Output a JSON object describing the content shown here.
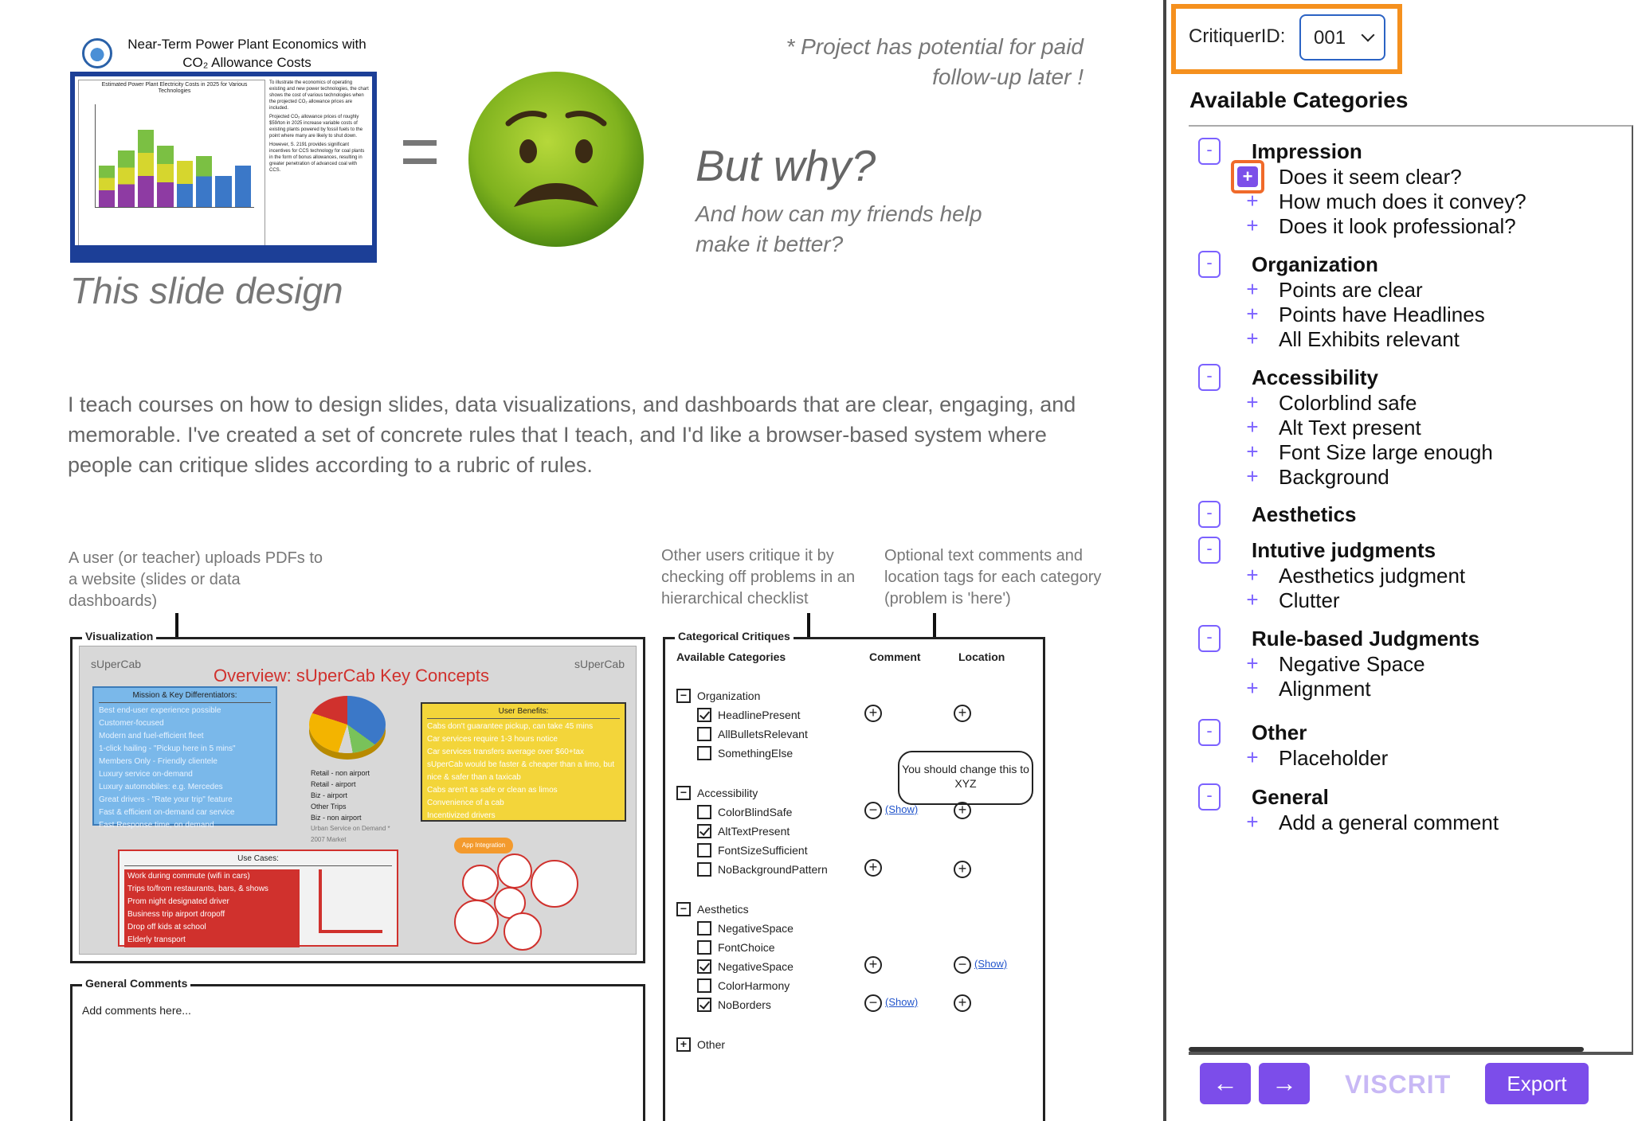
{
  "slide": {
    "thumb_title": "Near-Term Power Plant Economics with CO₂ Allowance Costs",
    "thumb_chart_title": "Estimated Power Plant Electricity Costs in 2025 for Various Technologies",
    "thumb_notes": [
      "To illustrate the economics of operating existing and new power technologies, the chart shows the cost of various technologies when the projected CO₂ allowance prices are included.",
      "Projected CO₂ allowance prices of roughly $59/ton in 2025 increase variable costs of existing plants powered by fossil fuels to the point where many are likely to shut down.",
      "However, S. 2191 provides significant incentives for CCS technology for coal plants in the form of bonus allowances, resulting in greater penetration of advanced coal with CCS."
    ],
    "caption_design": "This slide design",
    "note_top": "* Project has potential for paid follow-up later !",
    "but_why": "But why?",
    "friends": "And how can my friends help make it better?",
    "intro": "I teach courses on how to design slides, data visualizations, and dashboards that are clear, engaging, and memorable. I've created a set of concrete rules that I teach, and I'd like a browser-based system where people can critique slides according to a rubric of rules.",
    "anno_upload": "A user (or teacher) uploads PDFs to a website (slides or data dashboards)",
    "anno_critique": "Other users critique it by checking off problems in an hierarchical checklist",
    "anno_comments": "Optional text comments and location tags for each category (problem is 'here')"
  },
  "mock_viz": {
    "label": "Visualization",
    "brand_left": "sUperCab",
    "brand_right": "sUperCab",
    "title": "Overview: sUperCab Key Concepts",
    "mission_title": "Mission & Key Differentiators:",
    "mission_items": [
      "Best end-user experience possible",
      "Customer-focused",
      "Modern and fuel-efficient fleet",
      "1-click hailing - \"Pickup here in 5 mins\"",
      "Members Only - Friendly clientele",
      "Luxury service on-demand",
      "Luxury automobiles: e.g. Mercedes",
      "Great drivers - \"Rate your trip\" feature",
      "Fast & efficient on-demand car service",
      "Fast Response time, on demand"
    ],
    "benefits_title": "User Benefits:",
    "benefits_items": [
      "Cabs don't guarantee pickup, can take 45 mins",
      "Car services require 1-3 hours notice",
      "Car services transfers average over $60+tax",
      "sUperCab would be faster & cheaper than a limo, but nice & safer than a taxicab",
      "Cabs aren't as safe or clean as limos",
      "Convenience of a cab",
      "Incentivized drivers"
    ],
    "legend": [
      "Retail - non airport",
      "Retail - airport",
      "Biz - airport",
      "Other Trips",
      "Biz - non airport"
    ],
    "legend_note": "Urban Service on Demand * 2007 Market",
    "usecases_title": "Use Cases:",
    "usecases_items": [
      "Work during commute (wifi in cars)",
      "Trips to/from restaurants, bars, & shows",
      "Prom night designated driver",
      "Business trip airport dropoff",
      "Drop off kids at school",
      "Elderly transport"
    ],
    "app_label": "App Integration"
  },
  "mock_gc": {
    "label": "General Comments",
    "placeholder": "Add comments here..."
  },
  "mock_cat": {
    "label": "Categorical Critiques",
    "avail": "Available Categories",
    "comment_col": "Comment",
    "location_col": "Location",
    "org": "Organization",
    "org_items": [
      "HeadlinePresent",
      "AllBulletsRelevant",
      "SomethingElse"
    ],
    "acc": "Accessibility",
    "acc_items": [
      "ColorBlindSafe",
      "AltTextPresent",
      "FontSizeSufficient",
      "NoBackgroundPattern"
    ],
    "aes": "Aesthetics",
    "aes_items": [
      "NegativeSpace",
      "FontChoice",
      "NegativeSpace",
      "ColorHarmony",
      "NoBorders"
    ],
    "other": "Other",
    "bubble": "You should change this to XYZ",
    "show": "(Show)"
  },
  "panel": {
    "critiquer_label": "CritiquerID:",
    "critiquer_value": "001",
    "available_title": "Available Categories",
    "groups": [
      {
        "title": "Impression",
        "items": [
          "Does it seem clear?",
          "How much does it convey?",
          "Does it look professional?"
        ]
      },
      {
        "title": "Organization",
        "items": [
          "Points are clear",
          "Points have Headlines",
          "All Exhibits relevant"
        ]
      },
      {
        "title": "Accessibility",
        "items": [
          "Colorblind safe",
          "Alt Text present",
          "Font Size large enough",
          "Background"
        ]
      },
      {
        "title": "Aesthetics",
        "items": []
      },
      {
        "title": "Intutive judgments",
        "items": [
          "Aesthetics judgment",
          "Clutter"
        ]
      },
      {
        "title": "Rule-based Judgments",
        "items": [
          "Negative Space",
          "Alignment"
        ]
      },
      {
        "title": "Other",
        "items": [
          "Placeholder"
        ]
      },
      {
        "title": "General",
        "items": [
          "Add a general comment"
        ]
      }
    ],
    "prev_label": "←",
    "next_label": "→",
    "brand": "VISCRIT",
    "export_label": "Export"
  },
  "colors": {
    "accent": "#7c4dea",
    "highlight": "#f5901e",
    "select_border": "#2b63c4"
  }
}
